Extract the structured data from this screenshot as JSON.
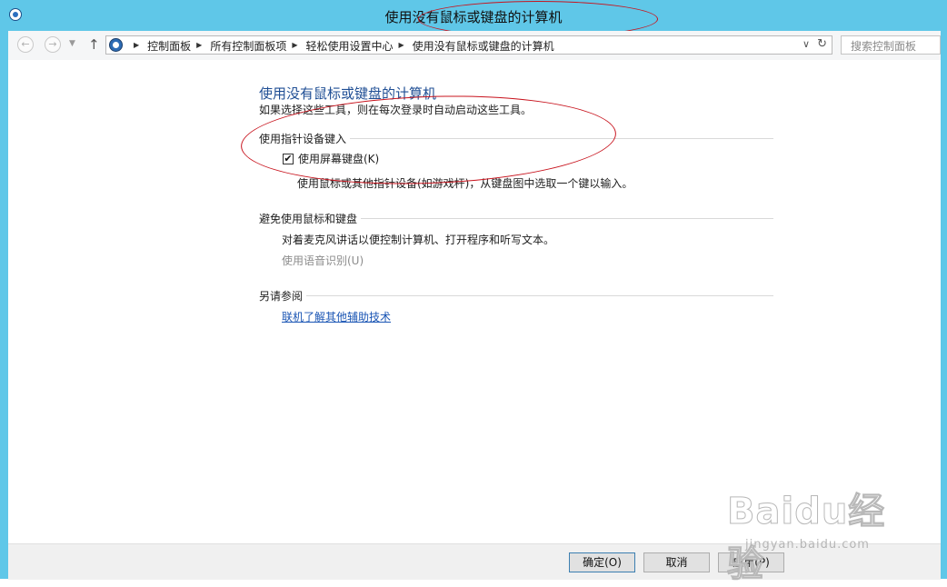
{
  "window": {
    "title": "使用没有鼠标或键盘的计算机",
    "frame_color": "#5fc7e8"
  },
  "nav": {
    "back_glyph": "←",
    "forward_glyph": "→",
    "dropdown_glyph": "▼",
    "up_glyph": "↑",
    "breadcrumbs": [
      "控制面板",
      "所有控制面板项",
      "轻松使用设置中心",
      "使用没有鼠标或键盘的计算机"
    ],
    "separator": "▶",
    "address_dropdown_glyph": "∨",
    "refresh_glyph": "↻",
    "search_placeholder": "搜索控制面板"
  },
  "main": {
    "title": "使用没有鼠标或键盘的计算机",
    "description": "如果选择这些工具，则在每次登录时自动启动这些工具。",
    "pointing_section": {
      "heading": "使用指针设备键入",
      "checkbox_label": "使用屏幕键盘(K)",
      "checkbox_checked": true,
      "checkbox_mark": "✔",
      "description": "使用鼠标或其他指针设备(如游戏杆)，从键盘图中选取一个键以输入。"
    },
    "avoid_section": {
      "heading": "避免使用鼠标和键盘",
      "description": "对着麦克风讲话以便控制计算机、打开程序和听写文本。",
      "link": "使用语音识别(U)"
    },
    "see_also_section": {
      "heading": "另请参阅",
      "link": "联机了解其他辅助技术"
    }
  },
  "buttons": {
    "ok": "确定(O)",
    "cancel": "取消",
    "apply": "应用(P)"
  },
  "watermark": {
    "brand": "Baidu经验",
    "url": "jingyan.baidu.com"
  },
  "colors": {
    "title_blue": "#1f4e94",
    "link_blue": "#1a55b4",
    "disabled_link": "#8c8c8c",
    "annotation_red": "#c8141e"
  }
}
